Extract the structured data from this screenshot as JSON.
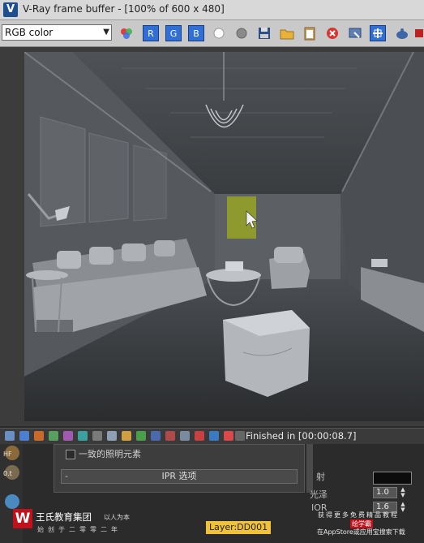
{
  "window": {
    "title": "V-Ray frame buffer - [100% of 600 x 480]",
    "app_icon": "V"
  },
  "toolbar": {
    "channel_value": "RGB color",
    "buttons": {
      "red_channel": "R",
      "green_channel": "G",
      "blue_channel": "B"
    }
  },
  "status": {
    "text": "Finished in [00:00:08.7]"
  },
  "settings_panel": {
    "checkbox_label": "一致的照明元素",
    "ipr_button_label": "IPR 选项",
    "ipr_dash": "-"
  },
  "right_params": {
    "label_refraction_partial": "射",
    "label_gloss_partial": "光泽",
    "label_ior": "IOR",
    "gloss_value": "1.0",
    "ior_value": "1.6"
  },
  "left_strip": {
    "hf_label": "HF",
    "ratio_label": "0.t"
  },
  "watermark": {
    "logo_letter": "W",
    "company": "王氏教育集团",
    "slogan": "以人为本",
    "since": "始创于二零零二年",
    "promo_line1": "获得更多免费精品教程",
    "promo_brand": "绘学霸",
    "promo_line3": "在AppStore或应用宝搜索下载"
  },
  "layer_badge": "Layer:DD001",
  "colors": {
    "titlebar": "#d8d8d8",
    "toolbar": "#c9c9c9",
    "channel_button": "#2f6fd6",
    "status_bar": "#3a3a3a",
    "brand_red": "#c0121a",
    "layer_badge": "#f0c23a"
  }
}
